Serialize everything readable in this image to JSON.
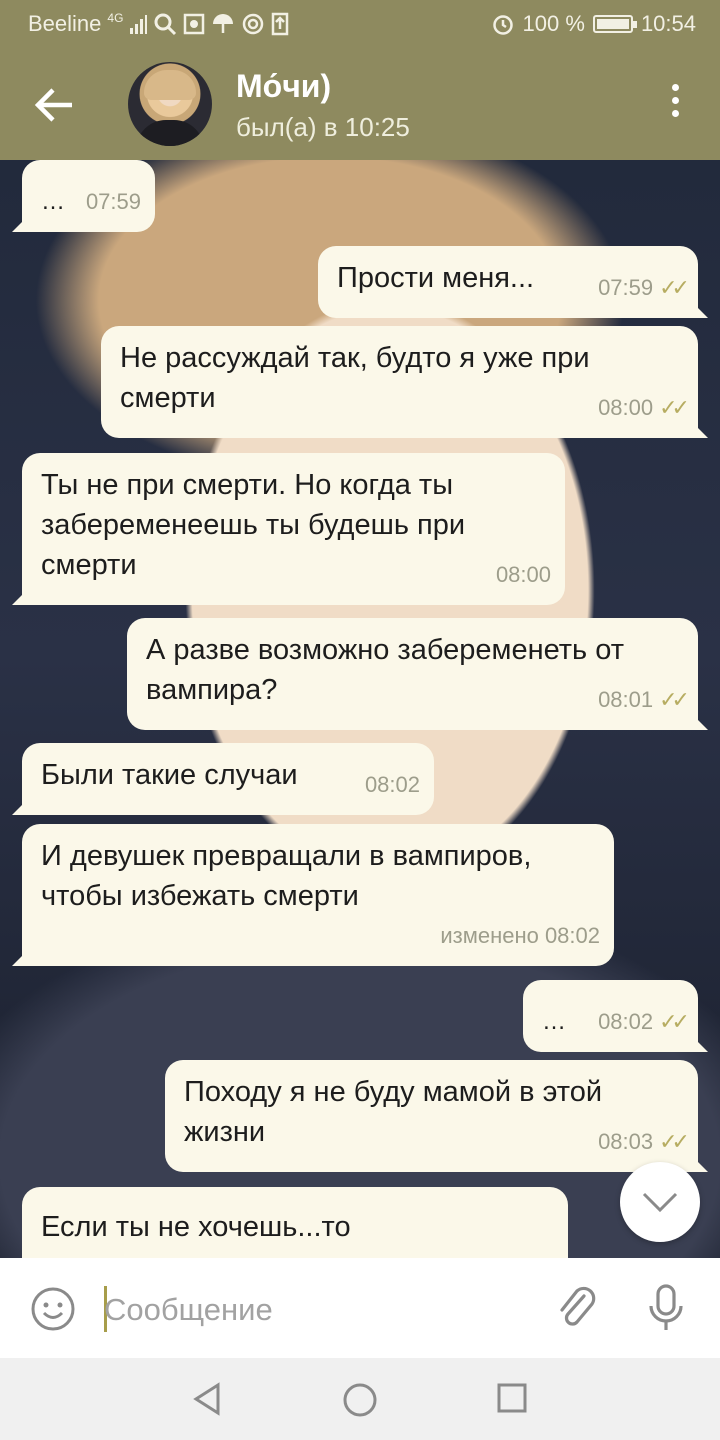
{
  "status_bar": {
    "carrier": "Beeline",
    "network": "4G",
    "battery": "100 %",
    "time": "10:54",
    "icons": [
      "signal-icon",
      "search-icon",
      "gallery-icon",
      "umbrella-icon",
      "at-icon",
      "upload-icon",
      "alarm-icon",
      "battery-icon"
    ]
  },
  "header": {
    "name": "Мо́чи)",
    "status": "был(а) в 10:25"
  },
  "messages": [
    {
      "dir": "in",
      "text": "…",
      "time": "07:59"
    },
    {
      "dir": "out",
      "text": "Прости меня...",
      "time": "07:59"
    },
    {
      "dir": "out",
      "text": "Не рассуждай так, будто я уже при смерти",
      "time": "08:00"
    },
    {
      "dir": "in",
      "text": "Ты не при смерти. Но когда ты забеременеешь ты будешь при смерти",
      "time": "08:00"
    },
    {
      "dir": "out",
      "text": "А разве возможно забеременеть от вампира?",
      "time": "08:01"
    },
    {
      "dir": "in",
      "text": "Были такие случаи",
      "time": "08:02"
    },
    {
      "dir": "in",
      "text": "И девушек превращали в вампиров, чтобы избежать смерти",
      "time": "изменено 08:02"
    },
    {
      "dir": "out",
      "text": "…",
      "time": "08:02"
    },
    {
      "dir": "out",
      "text": "Походу я не буду мамой в этой жизни",
      "time": "08:03"
    },
    {
      "dir": "in",
      "text": "Если ты не хочешь...то",
      "time": ""
    }
  ],
  "composer": {
    "placeholder": "Сообщение"
  }
}
